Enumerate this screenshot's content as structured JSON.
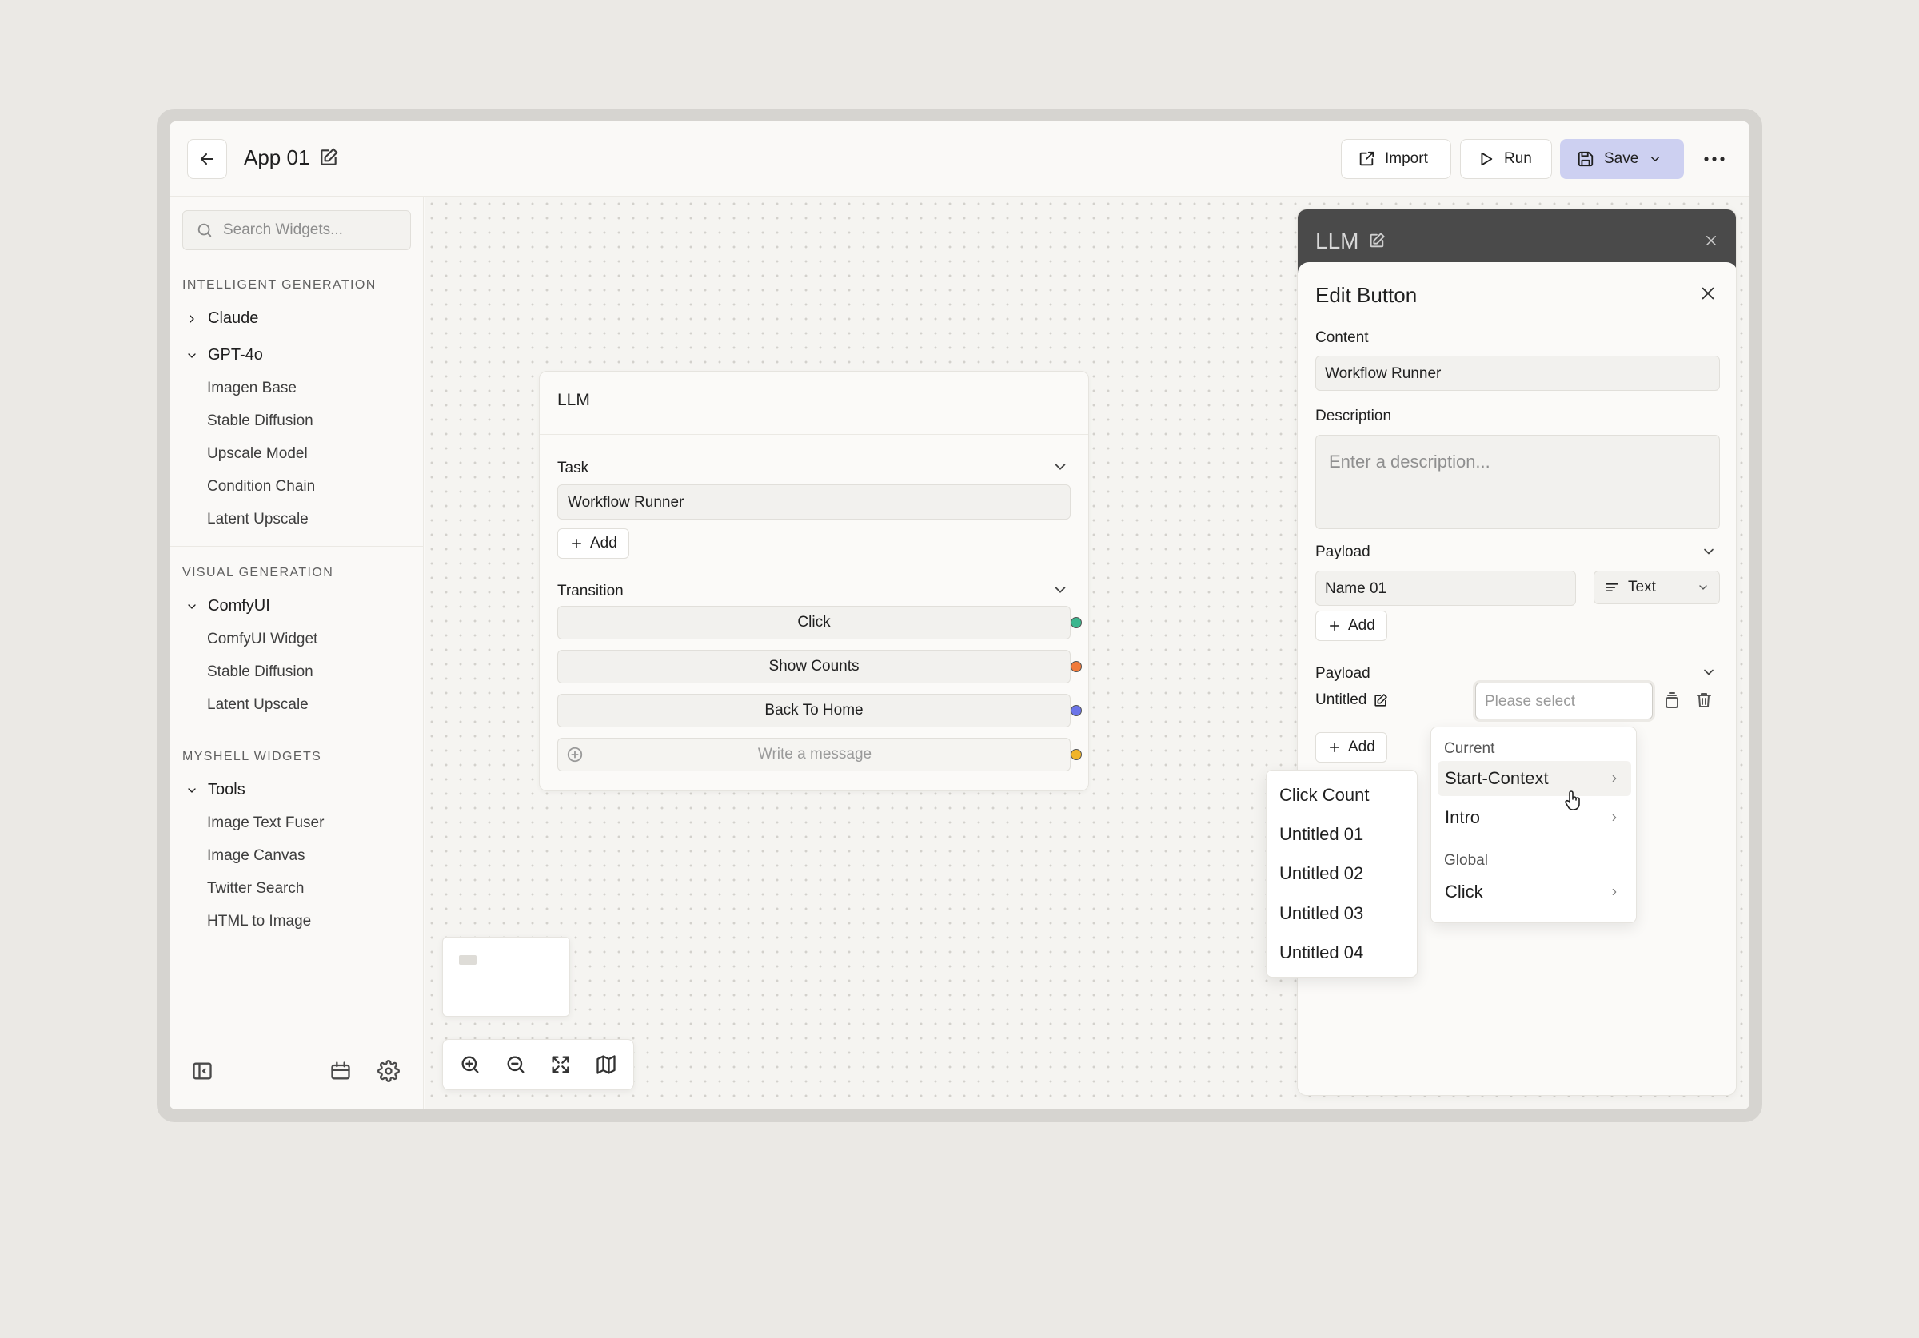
{
  "header": {
    "app_title": "App 01",
    "import_label": "Import",
    "run_label": "Run",
    "save_label": "Save"
  },
  "sidebar": {
    "search_placeholder": "Search Widgets...",
    "sections": [
      {
        "title": "INTELLIGENT GENERATION",
        "groups": [
          {
            "label": "Claude",
            "expanded": false,
            "items": []
          },
          {
            "label": "GPT-4o",
            "expanded": true,
            "items": [
              "Imagen Base",
              "Stable Diffusion",
              "Upscale Model",
              "Condition Chain",
              "Latent Upscale"
            ]
          }
        ]
      },
      {
        "title": "VISUAL GENERATION",
        "groups": [
          {
            "label": "ComfyUI",
            "expanded": true,
            "items": [
              "ComfyUI Widget",
              "Stable Diffusion",
              "Latent Upscale"
            ]
          }
        ]
      },
      {
        "title": "MYSHELL WIDGETS",
        "groups": [
          {
            "label": "Tools",
            "expanded": true,
            "items": [
              "Image Text Fuser",
              "Image Canvas",
              "Twitter Search",
              "HTML to Image"
            ]
          }
        ]
      }
    ]
  },
  "node": {
    "title": "LLM",
    "task_label": "Task",
    "task_value": "Workflow Runner",
    "add_label": "Add",
    "transition_label": "Transition",
    "transitions": [
      {
        "label": "Click",
        "color": "#3bb68e"
      },
      {
        "label": "Show Counts",
        "color": "#f07a3a"
      },
      {
        "label": "Back To Home",
        "color": "#6b74e8"
      }
    ],
    "message_placeholder": "Write a message",
    "message_dot_color": "#f0b429"
  },
  "panel": {
    "top_title": "LLM",
    "title": "Edit Button",
    "content_label": "Content",
    "content_value": "Workflow Runner",
    "description_label": "Description",
    "description_placeholder": "Enter a description...",
    "payload1_label": "Payload",
    "payload1_name": "Name 01",
    "payload1_type": "Text",
    "add_label": "Add",
    "payload2_label": "Payload",
    "payload2_name": "Untitled",
    "select_placeholder": "Please select"
  },
  "menu_right": {
    "current_header": "Current",
    "current_items": [
      "Start-Context",
      "Intro"
    ],
    "global_header": "Global",
    "global_items": [
      "Click"
    ]
  },
  "menu_left": {
    "items": [
      "Click Count",
      "Untitled 01",
      "Untitled 02",
      "Untitled 03",
      "Untitled 04"
    ]
  },
  "colors": {
    "accent_save": "#cdd0f1",
    "panel_top": "#4a4a4a"
  }
}
